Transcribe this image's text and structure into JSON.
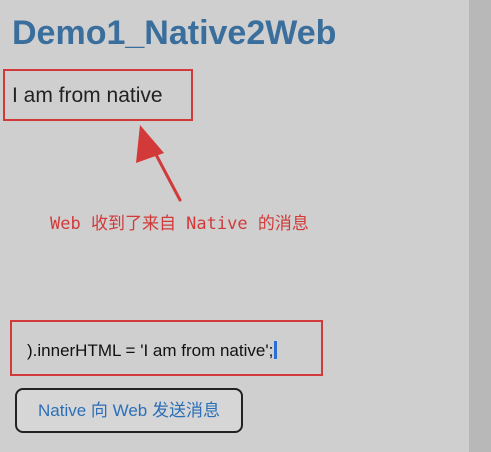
{
  "page": {
    "title": "Demo1_Native2Web"
  },
  "message": {
    "text": "I am from native"
  },
  "annotation": {
    "text": "Web 收到了来自 Native 的消息"
  },
  "code_input": {
    "value": ").innerHTML = 'I am from native';"
  },
  "send_button": {
    "label": "Native 向 Web 发送消息"
  },
  "colors": {
    "background": "#cfcfcf",
    "title": "#3a6e9c",
    "annotation_red": "#d23a3a",
    "button_text": "#2a6fb8",
    "cursor": "#2b6fd6"
  },
  "icons": {
    "arrow": "red-arrow-up-left-icon"
  }
}
